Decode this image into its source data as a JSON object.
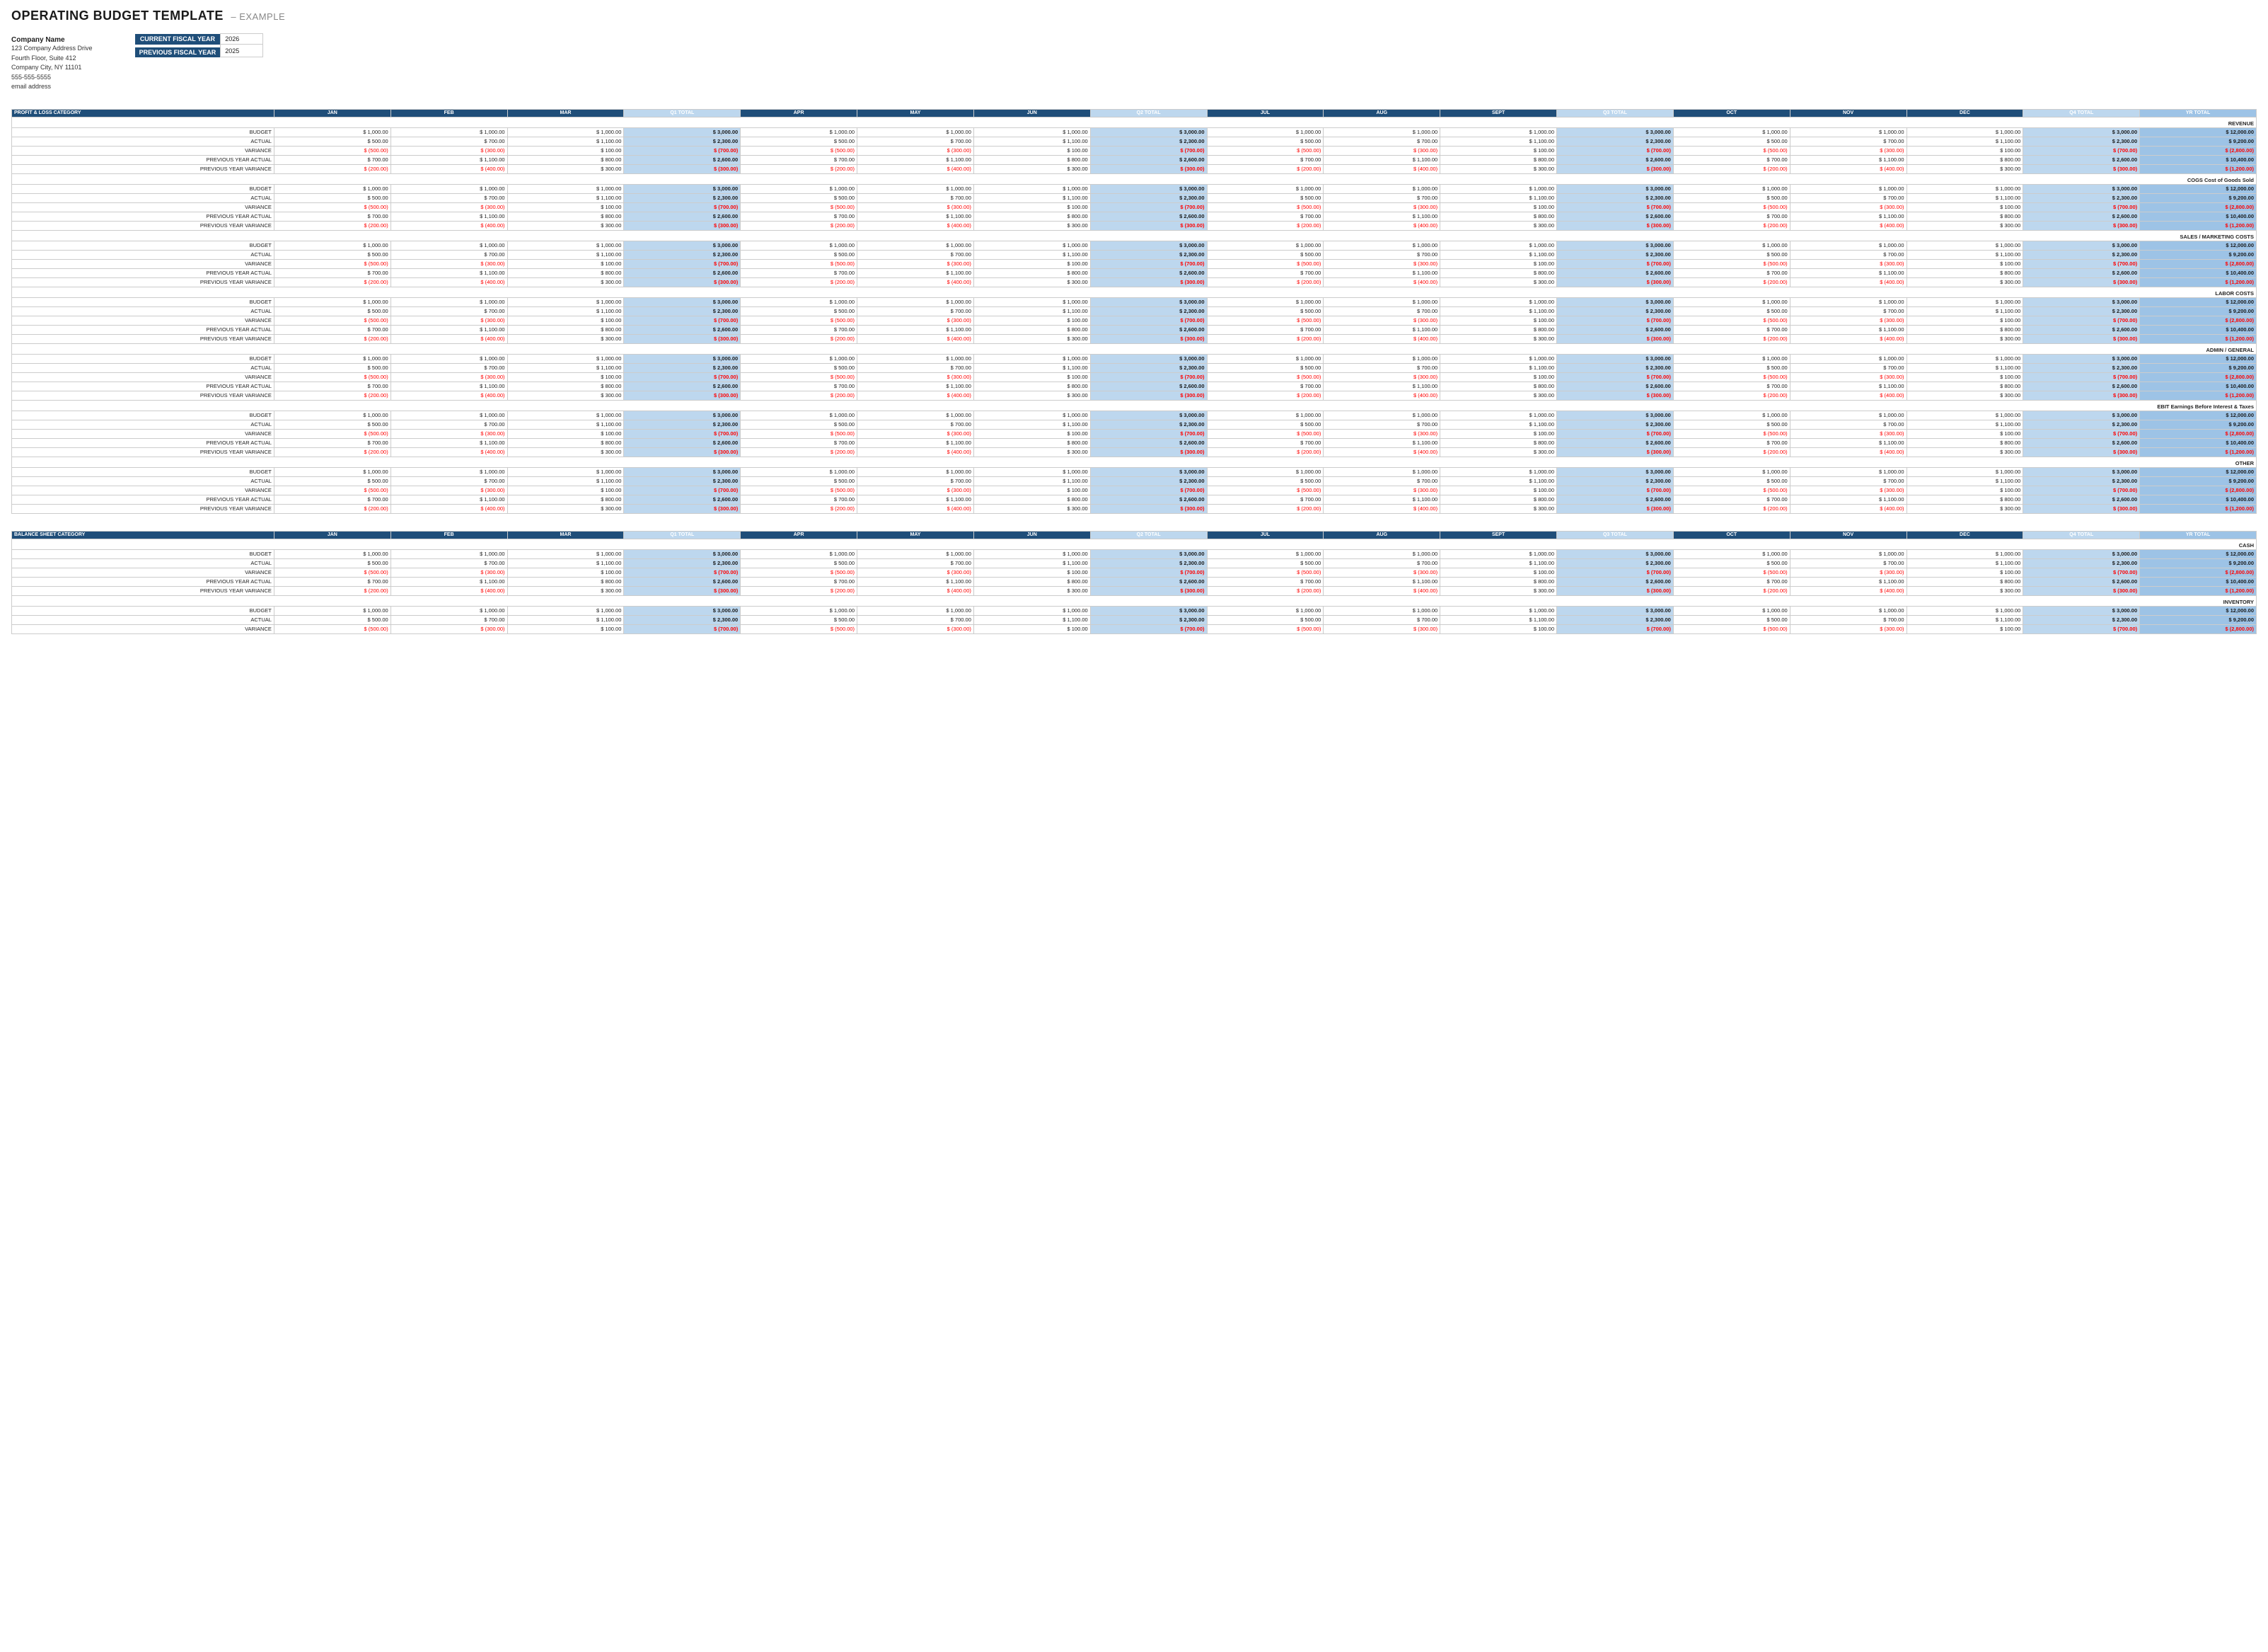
{
  "title": "OPERATING BUDGET TEMPLATE",
  "example": "– EXAMPLE",
  "company": {
    "name": "Company Name",
    "address1": "123 Company Address Drive",
    "address2": "Fourth Floor, Suite 412",
    "address3": "Company City, NY 11101",
    "phone": "555-555-5555",
    "email": "email address"
  },
  "fiscal_labels": {
    "current": "CURRENT FISCAL YEAR",
    "current_value": "2026",
    "previous": "PREVIOUS FISCAL YEAR",
    "previous_value": "2025"
  },
  "pnl_header": "PROFIT & LOSS CATEGORY",
  "balance_header": "BALANCE SHEET CATEGORY",
  "col_headers": [
    "JAN",
    "FEB",
    "MAR",
    "Q1 TOTAL",
    "APR",
    "MAY",
    "JUN",
    "Q2 TOTAL",
    "JUL",
    "AUG",
    "SEPT",
    "Q3 TOTAL",
    "OCT",
    "NOV",
    "DEC",
    "Q4 TOTAL",
    "YR TOTAL"
  ],
  "sections": [
    {
      "name": "REVENUE",
      "rows": [
        {
          "label": "BUDGET",
          "type": "budget"
        },
        {
          "label": "ACTUAL",
          "type": "actual"
        },
        {
          "label": "VARIANCE",
          "type": "variance"
        },
        {
          "label": "PREVIOUS YEAR ACTUAL",
          "type": "prev_actual"
        },
        {
          "label": "PREVIOUS YEAR VARIANCE",
          "type": "prev_variance"
        }
      ]
    },
    {
      "name": "COGS Cost of Goods Sold",
      "rows": [
        {
          "label": "BUDGET",
          "type": "budget"
        },
        {
          "label": "ACTUAL",
          "type": "actual"
        },
        {
          "label": "VARIANCE",
          "type": "variance"
        },
        {
          "label": "PREVIOUS YEAR ACTUAL",
          "type": "prev_actual"
        },
        {
          "label": "PREVIOUS YEAR VARIANCE",
          "type": "prev_variance"
        }
      ]
    },
    {
      "name": "SALES / MARKETING COSTS",
      "rows": [
        {
          "label": "BUDGET",
          "type": "budget"
        },
        {
          "label": "ACTUAL",
          "type": "actual"
        },
        {
          "label": "VARIANCE",
          "type": "variance"
        },
        {
          "label": "PREVIOUS YEAR ACTUAL",
          "type": "prev_actual"
        },
        {
          "label": "PREVIOUS YEAR VARIANCE",
          "type": "prev_variance"
        }
      ]
    },
    {
      "name": "LABOR COSTS",
      "rows": [
        {
          "label": "BUDGET",
          "type": "budget"
        },
        {
          "label": "ACTUAL",
          "type": "actual"
        },
        {
          "label": "VARIANCE",
          "type": "variance"
        },
        {
          "label": "PREVIOUS YEAR ACTUAL",
          "type": "prev_actual"
        },
        {
          "label": "PREVIOUS YEAR VARIANCE",
          "type": "prev_variance"
        }
      ]
    },
    {
      "name": "ADMIN / GENERAL",
      "rows": [
        {
          "label": "BUDGET",
          "type": "budget"
        },
        {
          "label": "ACTUAL",
          "type": "actual"
        },
        {
          "label": "VARIANCE",
          "type": "variance"
        },
        {
          "label": "PREVIOUS YEAR ACTUAL",
          "type": "prev_actual"
        },
        {
          "label": "PREVIOUS YEAR VARIANCE",
          "type": "prev_variance"
        }
      ]
    },
    {
      "name": "EBIT Earnings Before Interest & Taxes",
      "rows": [
        {
          "label": "BUDGET",
          "type": "budget"
        },
        {
          "label": "ACTUAL",
          "type": "actual"
        },
        {
          "label": "VARIANCE",
          "type": "variance"
        },
        {
          "label": "PREVIOUS YEAR ACTUAL",
          "type": "prev_actual"
        },
        {
          "label": "PREVIOUS YEAR VARIANCE",
          "type": "prev_variance"
        }
      ]
    },
    {
      "name": "OTHER",
      "rows": [
        {
          "label": "BUDGET",
          "type": "budget"
        },
        {
          "label": "ACTUAL",
          "type": "actual"
        },
        {
          "label": "VARIANCE",
          "type": "variance"
        },
        {
          "label": "PREVIOUS YEAR ACTUAL",
          "type": "prev_actual"
        },
        {
          "label": "PREVIOUS YEAR VARIANCE",
          "type": "prev_variance"
        }
      ]
    }
  ],
  "balance_sections": [
    {
      "name": "CASH",
      "rows": [
        {
          "label": "BUDGET",
          "type": "budget"
        },
        {
          "label": "ACTUAL",
          "type": "actual"
        },
        {
          "label": "VARIANCE",
          "type": "variance"
        },
        {
          "label": "PREVIOUS YEAR ACTUAL",
          "type": "prev_actual"
        },
        {
          "label": "PREVIOUS YEAR VARIANCE",
          "type": "prev_variance"
        }
      ]
    },
    {
      "name": "INVENTORY",
      "rows": [
        {
          "label": "BUDGET",
          "type": "budget"
        },
        {
          "label": "ACTUAL",
          "type": "actual"
        },
        {
          "label": "VARIANCE",
          "type": "variance"
        }
      ]
    }
  ],
  "row_data": {
    "budget": [
      "$ 1,000.00",
      "$ 1,000.00",
      "$ 1,000.00",
      "$ 3,000.00",
      "$ 1,000.00",
      "$ 1,000.00",
      "$ 1,000.00",
      "$ 3,000.00",
      "$ 1,000.00",
      "$ 1,000.00",
      "$ 1,000.00",
      "$ 3,000.00",
      "$ 1,000.00",
      "$ 1,000.00",
      "$ 1,000.00",
      "$ 3,000.00",
      "$ 12,000.00"
    ],
    "actual": [
      "$ 500.00",
      "$ 700.00",
      "$ 1,100.00",
      "$ 2,300.00",
      "$ 500.00",
      "$ 700.00",
      "$ 1,100.00",
      "$ 2,300.00",
      "$ 500.00",
      "$ 700.00",
      "$ 1,100.00",
      "$ 2,300.00",
      "$ 500.00",
      "$ 700.00",
      "$ 1,100.00",
      "$ 2,300.00",
      "$ 9,200.00"
    ],
    "variance": [
      "$ (500.00)",
      "$ (300.00)",
      "$ 100.00",
      "$ (700.00)",
      "$ (500.00)",
      "$ (300.00)",
      "$ 100.00",
      "$ (700.00)",
      "$ (500.00)",
      "$ (300.00)",
      "$ 100.00",
      "$ (700.00)",
      "$ (500.00)",
      "$ (300.00)",
      "$ 100.00",
      "$ (700.00)",
      "$ (2,800.00)"
    ],
    "prev_actual": [
      "$ 700.00",
      "$ 1,100.00",
      "$ 800.00",
      "$ 2,600.00",
      "$ 700.00",
      "$ 1,100.00",
      "$ 800.00",
      "$ 2,600.00",
      "$ 700.00",
      "$ 1,100.00",
      "$ 800.00",
      "$ 2,600.00",
      "$ 700.00",
      "$ 1,100.00",
      "$ 800.00",
      "$ 2,600.00",
      "$ 10,400.00"
    ],
    "prev_variance": [
      "$ (200.00)",
      "$ (400.00)",
      "$ 300.00",
      "$ (300.00)",
      "$ (200.00)",
      "$ (400.00)",
      "$ 300.00",
      "$ (300.00)",
      "$ (200.00)",
      "$ (400.00)",
      "$ 300.00",
      "$ (300.00)",
      "$ (200.00)",
      "$ (400.00)",
      "$ 300.00",
      "$ (300.00)",
      "$ (1,200.00)"
    ]
  }
}
